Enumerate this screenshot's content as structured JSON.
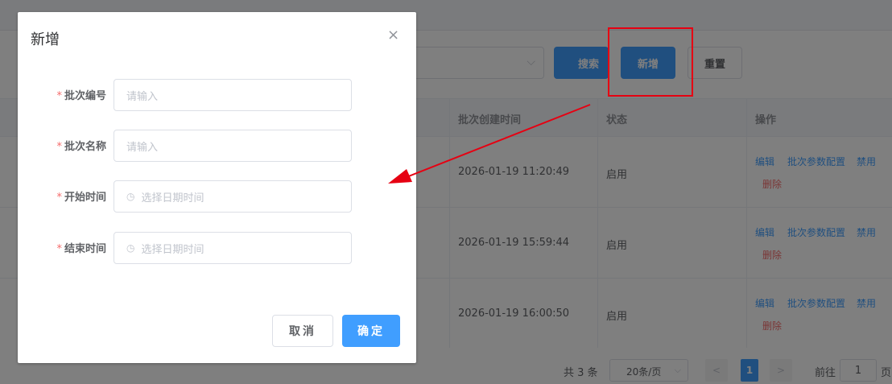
{
  "toolbar": {
    "search_label": "搜索",
    "add_label": "新增",
    "reset_label": "重置"
  },
  "table": {
    "headers": [
      "批次创建时间",
      "状态",
      "操作"
    ],
    "rows": [
      {
        "created": "2026-01-19 11:20:49",
        "status": "启用"
      },
      {
        "created": "2026-01-19 15:59:44",
        "status": "启用"
      },
      {
        "created": "2026-01-19 16:00:50",
        "status": "启用"
      }
    ],
    "ops": {
      "edit": "编辑",
      "config": "批次参数配置",
      "disable": "禁用",
      "delete": "删除"
    }
  },
  "pager": {
    "total": "共 3 条",
    "page_size": "20条/页",
    "prev": "<",
    "current": "1",
    "next": ">",
    "goto_prefix": "前往",
    "goto_value": "1",
    "goto_suffix": "页"
  },
  "dialog": {
    "title": "新增",
    "close": "×",
    "fields": [
      {
        "label": "批次编号",
        "placeholder": "请输入"
      },
      {
        "label": "批次名称",
        "placeholder": "请输入"
      },
      {
        "label": "开始时间",
        "placeholder": "选择日期时间"
      },
      {
        "label": "结束时间",
        "placeholder": "选择日期时间"
      }
    ],
    "required_mark": "*",
    "cancel_label": "取消",
    "ok_label": "确定"
  },
  "colors": {
    "primary": "#409eff",
    "danger": "#f56c6c",
    "annotation_red": "#e60012"
  },
  "icons": {
    "select_chevron": "chevron-down-icon",
    "clock": "clock-icon",
    "close": "close-icon"
  }
}
